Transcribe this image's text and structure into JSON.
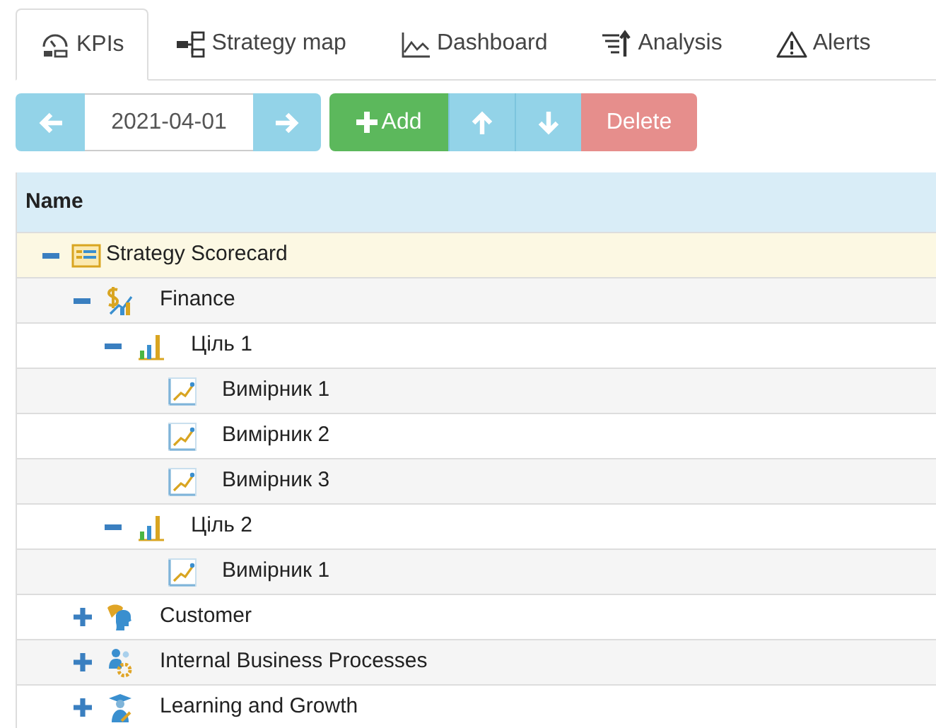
{
  "tabs": [
    {
      "label": "KPIs",
      "kind": "gauge",
      "selected": true
    },
    {
      "label": "Strategy map",
      "kind": "map",
      "selected": false
    },
    {
      "label": "Dashboard",
      "kind": "chart",
      "selected": false
    },
    {
      "label": "Analysis",
      "kind": "sort",
      "selected": false
    },
    {
      "label": "Alerts",
      "kind": "alert",
      "selected": false
    }
  ],
  "toolbar": {
    "date": "2021-04-01",
    "add_label": "Add",
    "delete_label": "Delete"
  },
  "table": {
    "columns": [
      "Name"
    ],
    "rows": [
      {
        "name": "Strategy Scorecard",
        "kind": "scorecard",
        "expanded": true,
        "selected": true,
        "children": [
          {
            "name": "Finance",
            "kind": "finance",
            "expanded": true,
            "selected": false,
            "children": [
              {
                "name": "Ціль 1",
                "kind": "goal",
                "expanded": true,
                "selected": false,
                "children": [
                  {
                    "name": "Вимірник 1",
                    "kind": "measure",
                    "selected": false
                  },
                  {
                    "name": "Вимірник 2",
                    "kind": "measure",
                    "selected": false
                  },
                  {
                    "name": "Вимірник 3",
                    "kind": "measure",
                    "selected": false
                  }
                ]
              },
              {
                "name": "Ціль 2",
                "kind": "goal",
                "expanded": true,
                "selected": false,
                "children": [
                  {
                    "name": "Вимірник 1",
                    "kind": "measure",
                    "selected": false
                  }
                ]
              }
            ]
          },
          {
            "name": "Customer",
            "kind": "customer",
            "expanded": false,
            "selected": false
          },
          {
            "name": "Internal Business Processes",
            "kind": "process",
            "expanded": false,
            "selected": false
          },
          {
            "name": "Learning and Growth",
            "kind": "learning",
            "expanded": false,
            "selected": false
          }
        ]
      }
    ]
  }
}
